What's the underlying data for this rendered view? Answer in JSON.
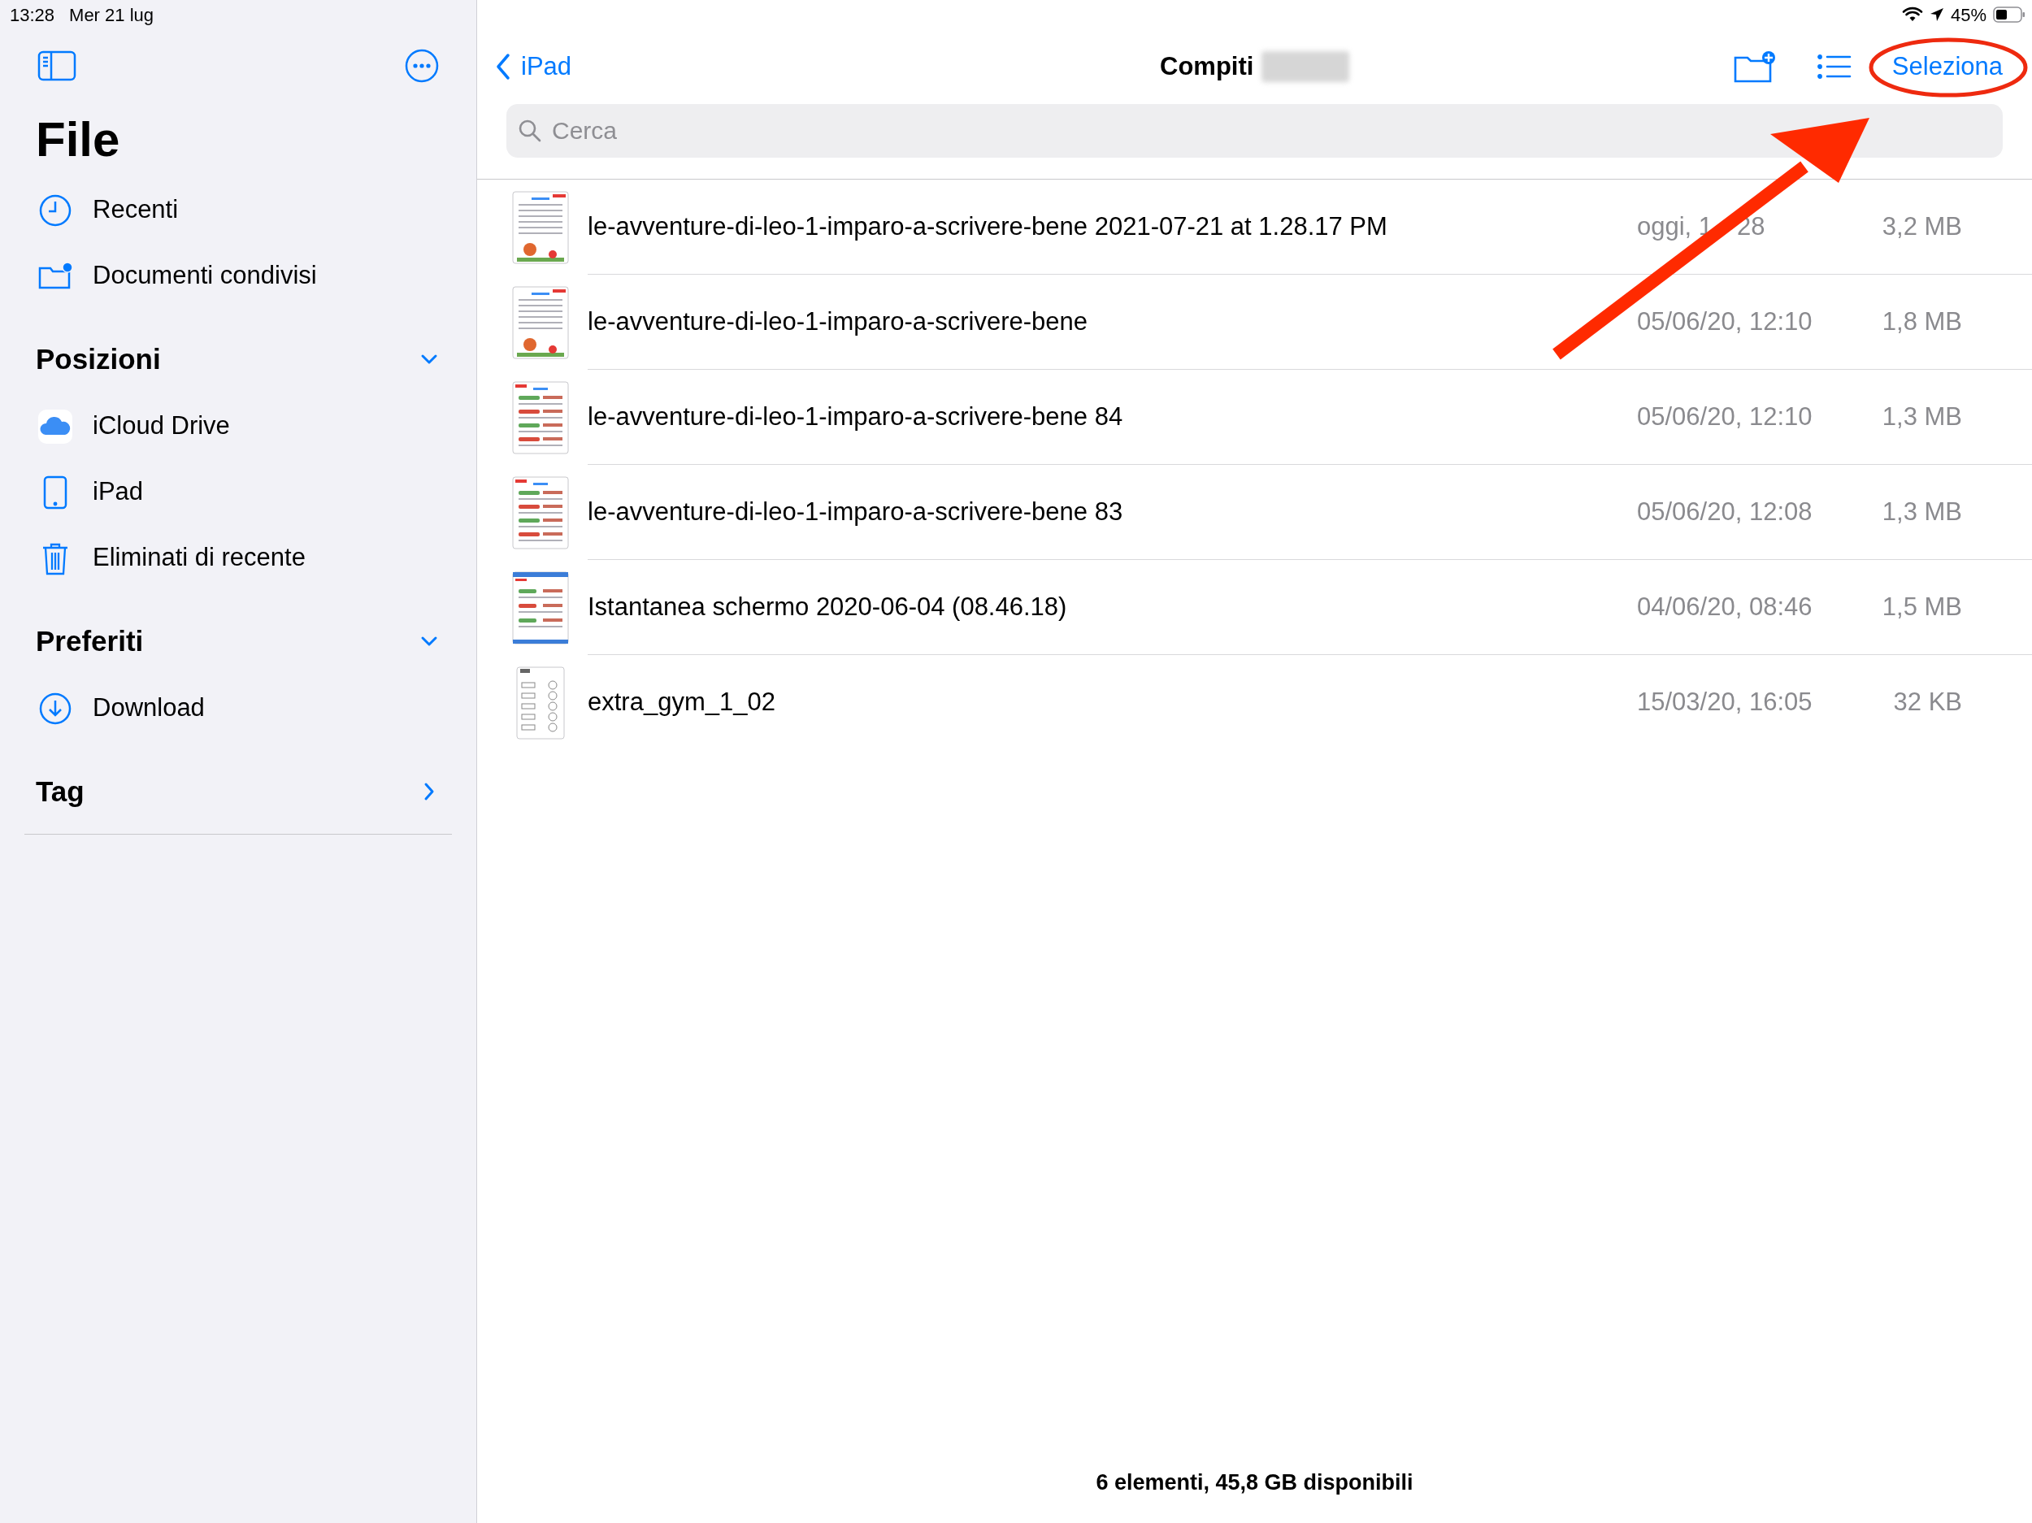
{
  "status_bar": {
    "time": "13:28",
    "date": "Mer 21 lug",
    "battery": "45%"
  },
  "sidebar": {
    "title": "File",
    "top_items": [
      {
        "label": "Recenti",
        "kind": "clock"
      },
      {
        "label": "Documenti condivisi",
        "kind": "shared-folder"
      }
    ],
    "sections": [
      {
        "title": "Posizioni",
        "expanded": true,
        "items": [
          {
            "label": "iCloud Drive",
            "kind": "cloud"
          },
          {
            "label": "iPad",
            "kind": "tablet"
          },
          {
            "label": "Eliminati di recente",
            "kind": "trash"
          }
        ]
      },
      {
        "title": "Preferiti",
        "expanded": true,
        "items": [
          {
            "label": "Download",
            "kind": "download"
          }
        ]
      },
      {
        "title": "Tag",
        "expanded": false
      }
    ]
  },
  "nav": {
    "back_label": "iPad",
    "title": "Compiti",
    "select_button": "Seleziona"
  },
  "search": {
    "placeholder": "Cerca"
  },
  "files": [
    {
      "name": "le-avventure-di-leo-1-imparo-a-scrivere-bene 2021-07-21 at 1.28.17 PM",
      "date": "oggi, 1",
      "date_after_arrow": "28",
      "size": "3,2 MB",
      "kind": "illustrated"
    },
    {
      "name": "le-avventure-di-leo-1-imparo-a-scrivere-bene",
      "date": "05/06/20, 12:10",
      "size": "1,8 MB",
      "kind": "illustrated"
    },
    {
      "name": "le-avventure-di-leo-1-imparo-a-scrivere-bene 84",
      "date": "05/06/20, 12:10",
      "size": "1,3 MB",
      "kind": "exercise"
    },
    {
      "name": "le-avventure-di-leo-1-imparo-a-scrivere-bene 83",
      "date": "05/06/20, 12:08",
      "size": "1,3 MB",
      "kind": "exercise"
    },
    {
      "name": "Istantanea schermo 2020-06-04 (08.46.18)",
      "date": "04/06/20, 08:46",
      "size": "1,5 MB",
      "kind": "screenshot"
    },
    {
      "name": "extra_gym_1_02",
      "date": "15/03/20, 16:05",
      "size": "32 KB",
      "kind": "worksheet"
    }
  ],
  "footer": "6 elementi, 45,8 GB disponibili"
}
